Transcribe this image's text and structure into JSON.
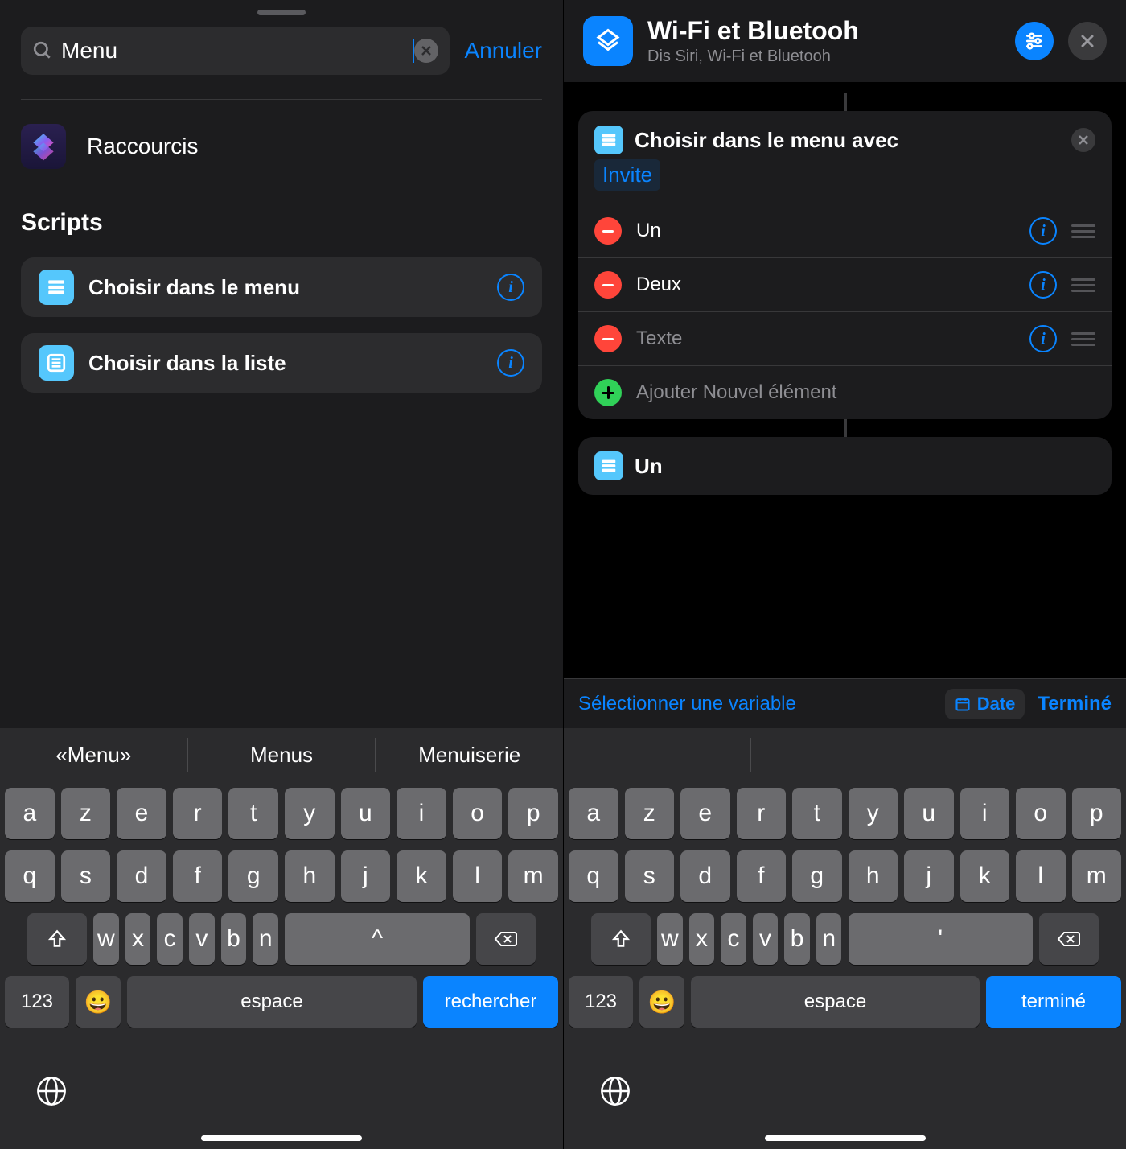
{
  "left": {
    "search": {
      "value": "Menu",
      "placeholder": ""
    },
    "cancel": "Annuler",
    "app_name": "Raccourcis",
    "category": "Scripts",
    "actions": [
      {
        "label": "Choisir dans le menu"
      },
      {
        "label": "Choisir dans la liste"
      }
    ],
    "suggestions": [
      "«Menu»",
      "Menus",
      "Menuiserie"
    ],
    "kb_action": "rechercher"
  },
  "right": {
    "title": "Wi-Fi et Bluetooh",
    "subtitle": "Dis Siri, Wi-Fi et Bluetooh",
    "module_title": "Choisir dans le menu avec",
    "prompt_placeholder": "Invite",
    "options": [
      {
        "label": "Un",
        "placeholder": false
      },
      {
        "label": "Deux",
        "placeholder": false
      },
      {
        "label": "Texte",
        "placeholder": true
      }
    ],
    "add_label": "Ajouter Nouvel élément",
    "module2_title": "Un",
    "var_select": "Sélectionner une variable",
    "var_chip": "Date",
    "var_done": "Terminé",
    "kb_action": "terminé"
  },
  "kb": {
    "row1": [
      "a",
      "z",
      "e",
      "r",
      "t",
      "y",
      "u",
      "i",
      "o",
      "p"
    ],
    "row2": [
      "q",
      "s",
      "d",
      "f",
      "g",
      "h",
      "j",
      "k",
      "l",
      "m"
    ],
    "row3": [
      "w",
      "x",
      "c",
      "v",
      "b",
      "n"
    ],
    "num": "123",
    "space": "espace"
  }
}
